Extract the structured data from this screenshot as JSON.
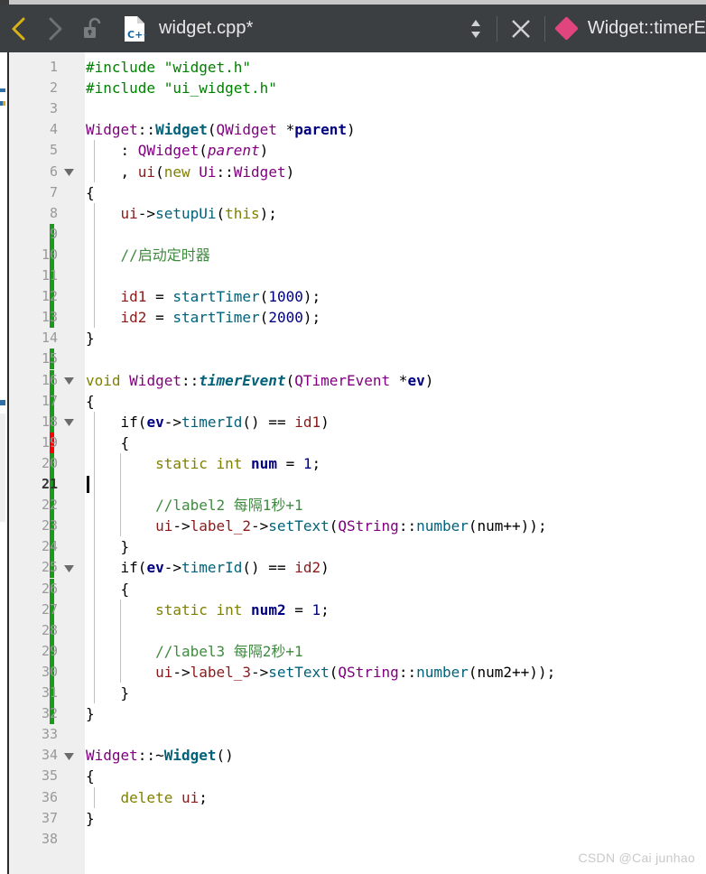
{
  "toolbar": {
    "back_icon": "chevron-left-icon",
    "forward_icon": "chevron-right-icon",
    "lock_icon": "unlock-icon",
    "file_type_icon": "cpp-file-icon",
    "file_type_label": "C++",
    "filename": "widget.cpp*",
    "spinner_icon": "updown-spinner-icon",
    "close_icon": "close-icon",
    "symbol_icon": "diamond-method-icon",
    "symbol_name": "Widget::timerE",
    "back_color": "#d9b218",
    "forward_color": "#6e7174",
    "symbol_icon_color": "#e0457b",
    "background": "#3c3f41"
  },
  "editor": {
    "gutter_bg": "#efefef",
    "current_line": 21,
    "change_color_added": "#1a9c1a",
    "change_color_modified": "#ff0000",
    "lines": [
      {
        "n": 1,
        "fold": false,
        "change": "none",
        "code": [
          {
            "t": "#include ",
            "c": "t-pre"
          },
          {
            "t": "\"widget.h\"",
            "c": "t-str"
          }
        ]
      },
      {
        "n": 2,
        "fold": false,
        "change": "none",
        "code": [
          {
            "t": "#include ",
            "c": "t-pre"
          },
          {
            "t": "\"ui_widget.h\"",
            "c": "t-str"
          }
        ]
      },
      {
        "n": 3,
        "fold": false,
        "change": "none",
        "code": []
      },
      {
        "n": 4,
        "fold": false,
        "change": "none",
        "code": [
          {
            "t": "Widget",
            "c": "t-type"
          },
          {
            "t": "::",
            "c": "t-op"
          },
          {
            "t": "Widget",
            "c": "t-fnb"
          },
          {
            "t": "(",
            "c": "t-op"
          },
          {
            "t": "QWidget",
            "c": "t-type"
          },
          {
            "t": " *",
            "c": "t-op"
          },
          {
            "t": "parent",
            "c": "t-param"
          },
          {
            "t": ")",
            "c": "t-op"
          }
        ]
      },
      {
        "n": 5,
        "fold": false,
        "change": "none",
        "code": [
          {
            "t": "    : ",
            "c": "t-op"
          },
          {
            "t": "QWidget",
            "c": "t-type"
          },
          {
            "t": "(",
            "c": "t-op"
          },
          {
            "t": "parent",
            "c": "t-parami"
          },
          {
            "t": ")",
            "c": "t-op"
          }
        ]
      },
      {
        "n": 6,
        "fold": true,
        "change": "none",
        "code": [
          {
            "t": "    , ",
            "c": "t-op"
          },
          {
            "t": "ui",
            "c": "t-var"
          },
          {
            "t": "(",
            "c": "t-op"
          },
          {
            "t": "new",
            "c": "t-kw"
          },
          {
            "t": " ",
            "c": "t-op"
          },
          {
            "t": "Ui",
            "c": "t-type"
          },
          {
            "t": "::",
            "c": "t-op"
          },
          {
            "t": "Widget",
            "c": "t-type"
          },
          {
            "t": ")",
            "c": "t-op"
          }
        ]
      },
      {
        "n": 7,
        "fold": false,
        "change": "none",
        "code": [
          {
            "t": "{",
            "c": "t-op"
          }
        ]
      },
      {
        "n": 8,
        "fold": false,
        "change": "none",
        "code": [
          {
            "t": "    ",
            "c": "t-op"
          },
          {
            "t": "ui",
            "c": "t-var"
          },
          {
            "t": "->",
            "c": "t-op"
          },
          {
            "t": "setupUi",
            "c": "t-fn"
          },
          {
            "t": "(",
            "c": "t-op"
          },
          {
            "t": "this",
            "c": "t-kw"
          },
          {
            "t": ");",
            "c": "t-op"
          }
        ]
      },
      {
        "n": 9,
        "fold": false,
        "change": "added",
        "code": []
      },
      {
        "n": 10,
        "fold": false,
        "change": "added",
        "code": [
          {
            "t": "    //启动定时器",
            "c": "t-cmt"
          }
        ]
      },
      {
        "n": 11,
        "fold": false,
        "change": "added",
        "code": []
      },
      {
        "n": 12,
        "fold": false,
        "change": "added",
        "code": [
          {
            "t": "    ",
            "c": "t-op"
          },
          {
            "t": "id1",
            "c": "t-var"
          },
          {
            "t": " = ",
            "c": "t-op"
          },
          {
            "t": "startTimer",
            "c": "t-fn"
          },
          {
            "t": "(",
            "c": "t-op"
          },
          {
            "t": "1000",
            "c": "t-num"
          },
          {
            "t": ");",
            "c": "t-op"
          }
        ]
      },
      {
        "n": 13,
        "fold": false,
        "change": "added",
        "code": [
          {
            "t": "    ",
            "c": "t-op"
          },
          {
            "t": "id2",
            "c": "t-var"
          },
          {
            "t": " = ",
            "c": "t-op"
          },
          {
            "t": "startTimer",
            "c": "t-fn"
          },
          {
            "t": "(",
            "c": "t-op"
          },
          {
            "t": "2000",
            "c": "t-num"
          },
          {
            "t": ");",
            "c": "t-op"
          }
        ]
      },
      {
        "n": 14,
        "fold": false,
        "change": "none",
        "code": [
          {
            "t": "}",
            "c": "t-op"
          }
        ]
      },
      {
        "n": 15,
        "fold": false,
        "change": "added",
        "code": []
      },
      {
        "n": 16,
        "fold": true,
        "change": "added",
        "code": [
          {
            "t": "void",
            "c": "t-kw"
          },
          {
            "t": " ",
            "c": "t-op"
          },
          {
            "t": "Widget",
            "c": "t-type"
          },
          {
            "t": "::",
            "c": "t-op"
          },
          {
            "t": "timerEvent",
            "c": "t-fnbi"
          },
          {
            "t": "(",
            "c": "t-op"
          },
          {
            "t": "QTimerEvent",
            "c": "t-type"
          },
          {
            "t": " *",
            "c": "t-op"
          },
          {
            "t": "ev",
            "c": "t-param"
          },
          {
            "t": ")",
            "c": "t-op"
          }
        ]
      },
      {
        "n": 17,
        "fold": false,
        "change": "added",
        "code": [
          {
            "t": "{",
            "c": "t-op"
          }
        ]
      },
      {
        "n": 18,
        "fold": true,
        "change": "added",
        "code": [
          {
            "t": "    ",
            "c": "t-op"
          },
          {
            "t": "if",
            "c": "t-op"
          },
          {
            "t": "(",
            "c": "t-op"
          },
          {
            "t": "ev",
            "c": "t-local"
          },
          {
            "t": "->",
            "c": "t-op"
          },
          {
            "t": "timerId",
            "c": "t-fn"
          },
          {
            "t": "() == ",
            "c": "t-op"
          },
          {
            "t": "id1",
            "c": "t-var"
          },
          {
            "t": ")",
            "c": "t-op"
          }
        ]
      },
      {
        "n": 19,
        "fold": false,
        "change": "modified",
        "code": [
          {
            "t": "    {",
            "c": "t-op"
          }
        ]
      },
      {
        "n": 20,
        "fold": false,
        "change": "added",
        "code": [
          {
            "t": "        ",
            "c": "t-op"
          },
          {
            "t": "static",
            "c": "t-kw"
          },
          {
            "t": " ",
            "c": "t-op"
          },
          {
            "t": "int",
            "c": "t-kw"
          },
          {
            "t": " ",
            "c": "t-op"
          },
          {
            "t": "num",
            "c": "t-local"
          },
          {
            "t": " = ",
            "c": "t-op"
          },
          {
            "t": "1",
            "c": "t-num"
          },
          {
            "t": ";",
            "c": "t-op"
          }
        ]
      },
      {
        "n": 21,
        "fold": false,
        "change": "added",
        "code": []
      },
      {
        "n": 22,
        "fold": false,
        "change": "added",
        "code": [
          {
            "t": "        //label2 每隔1秒+1",
            "c": "t-cmt"
          }
        ]
      },
      {
        "n": 23,
        "fold": false,
        "change": "added",
        "code": [
          {
            "t": "        ",
            "c": "t-op"
          },
          {
            "t": "ui",
            "c": "t-var"
          },
          {
            "t": "->",
            "c": "t-op"
          },
          {
            "t": "label_2",
            "c": "t-var"
          },
          {
            "t": "->",
            "c": "t-op"
          },
          {
            "t": "setText",
            "c": "t-fn"
          },
          {
            "t": "(",
            "c": "t-op"
          },
          {
            "t": "QString",
            "c": "t-type"
          },
          {
            "t": "::",
            "c": "t-op"
          },
          {
            "t": "number",
            "c": "t-fn"
          },
          {
            "t": "(num++));",
            "c": "t-op"
          }
        ]
      },
      {
        "n": 24,
        "fold": false,
        "change": "added",
        "code": [
          {
            "t": "    }",
            "c": "t-op"
          }
        ]
      },
      {
        "n": 25,
        "fold": true,
        "change": "added",
        "code": [
          {
            "t": "    ",
            "c": "t-op"
          },
          {
            "t": "if",
            "c": "t-op"
          },
          {
            "t": "(",
            "c": "t-op"
          },
          {
            "t": "ev",
            "c": "t-local"
          },
          {
            "t": "->",
            "c": "t-op"
          },
          {
            "t": "timerId",
            "c": "t-fn"
          },
          {
            "t": "() == ",
            "c": "t-op"
          },
          {
            "t": "id2",
            "c": "t-var"
          },
          {
            "t": ")",
            "c": "t-op"
          }
        ]
      },
      {
        "n": 26,
        "fold": false,
        "change": "added",
        "code": [
          {
            "t": "    {",
            "c": "t-op"
          }
        ]
      },
      {
        "n": 27,
        "fold": false,
        "change": "added",
        "code": [
          {
            "t": "        ",
            "c": "t-op"
          },
          {
            "t": "static",
            "c": "t-kw"
          },
          {
            "t": " ",
            "c": "t-op"
          },
          {
            "t": "int",
            "c": "t-kw"
          },
          {
            "t": " ",
            "c": "t-op"
          },
          {
            "t": "num2",
            "c": "t-local"
          },
          {
            "t": " = ",
            "c": "t-op"
          },
          {
            "t": "1",
            "c": "t-num"
          },
          {
            "t": ";",
            "c": "t-op"
          }
        ]
      },
      {
        "n": 28,
        "fold": false,
        "change": "added",
        "code": []
      },
      {
        "n": 29,
        "fold": false,
        "change": "added",
        "code": [
          {
            "t": "        //label3 每隔2秒+1",
            "c": "t-cmt"
          }
        ]
      },
      {
        "n": 30,
        "fold": false,
        "change": "added",
        "code": [
          {
            "t": "        ",
            "c": "t-op"
          },
          {
            "t": "ui",
            "c": "t-var"
          },
          {
            "t": "->",
            "c": "t-op"
          },
          {
            "t": "label_3",
            "c": "t-var"
          },
          {
            "t": "->",
            "c": "t-op"
          },
          {
            "t": "setText",
            "c": "t-fn"
          },
          {
            "t": "(",
            "c": "t-op"
          },
          {
            "t": "QString",
            "c": "t-type"
          },
          {
            "t": "::",
            "c": "t-op"
          },
          {
            "t": "number",
            "c": "t-fn"
          },
          {
            "t": "(num2++));",
            "c": "t-op"
          }
        ]
      },
      {
        "n": 31,
        "fold": false,
        "change": "added",
        "code": [
          {
            "t": "    }",
            "c": "t-op"
          }
        ]
      },
      {
        "n": 32,
        "fold": false,
        "change": "added",
        "code": [
          {
            "t": "}",
            "c": "t-op"
          }
        ]
      },
      {
        "n": 33,
        "fold": false,
        "change": "none",
        "code": []
      },
      {
        "n": 34,
        "fold": true,
        "change": "none",
        "code": [
          {
            "t": "Widget",
            "c": "t-type"
          },
          {
            "t": "::~",
            "c": "t-op"
          },
          {
            "t": "Widget",
            "c": "t-fnb"
          },
          {
            "t": "()",
            "c": "t-op"
          }
        ]
      },
      {
        "n": 35,
        "fold": false,
        "change": "none",
        "code": [
          {
            "t": "{",
            "c": "t-op"
          }
        ]
      },
      {
        "n": 36,
        "fold": false,
        "change": "none",
        "code": [
          {
            "t": "    ",
            "c": "t-op"
          },
          {
            "t": "delete",
            "c": "t-kw"
          },
          {
            "t": " ",
            "c": "t-op"
          },
          {
            "t": "ui",
            "c": "t-var"
          },
          {
            "t": ";",
            "c": "t-op"
          }
        ]
      },
      {
        "n": 37,
        "fold": false,
        "change": "none",
        "code": [
          {
            "t": "}",
            "c": "t-op"
          }
        ]
      },
      {
        "n": 38,
        "fold": false,
        "change": "none",
        "code": []
      }
    ]
  },
  "watermark": "CSDN @Cai junhao"
}
